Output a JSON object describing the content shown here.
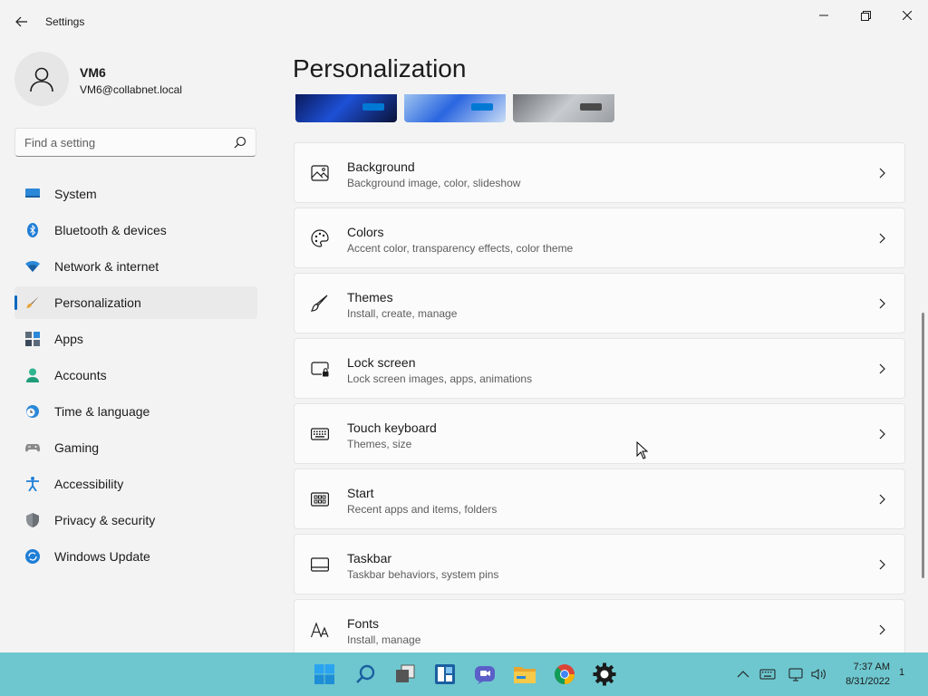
{
  "window": {
    "title": "Settings",
    "controls": {
      "minimize": "minimize",
      "maximize": "maximize",
      "close": "close"
    }
  },
  "profile": {
    "name": "VM6",
    "email": "VM6@collabnet.local"
  },
  "search": {
    "placeholder": "Find a setting"
  },
  "sidebar": {
    "items": [
      {
        "label": "System",
        "icon": "system-icon",
        "selected": false
      },
      {
        "label": "Bluetooth & devices",
        "icon": "bluetooth-icon",
        "selected": false
      },
      {
        "label": "Network & internet",
        "icon": "network-icon",
        "selected": false
      },
      {
        "label": "Personalization",
        "icon": "brush-icon",
        "selected": true
      },
      {
        "label": "Apps",
        "icon": "apps-icon",
        "selected": false
      },
      {
        "label": "Accounts",
        "icon": "accounts-icon",
        "selected": false
      },
      {
        "label": "Time & language",
        "icon": "time-language-icon",
        "selected": false
      },
      {
        "label": "Gaming",
        "icon": "gaming-icon",
        "selected": false
      },
      {
        "label": "Accessibility",
        "icon": "accessibility-icon",
        "selected": false
      },
      {
        "label": "Privacy & security",
        "icon": "shield-icon",
        "selected": false
      },
      {
        "label": "Windows Update",
        "icon": "windows-update-icon",
        "selected": false
      }
    ]
  },
  "main": {
    "title": "Personalization",
    "cards": [
      {
        "title": "Background",
        "subtitle": "Background image, color, slideshow",
        "icon": "image-icon"
      },
      {
        "title": "Colors",
        "subtitle": "Accent color, transparency effects, color theme",
        "icon": "palette-icon"
      },
      {
        "title": "Themes",
        "subtitle": "Install, create, manage",
        "icon": "brush-icon"
      },
      {
        "title": "Lock screen",
        "subtitle": "Lock screen images, apps, animations",
        "icon": "lock-screen-icon"
      },
      {
        "title": "Touch keyboard",
        "subtitle": "Themes, size",
        "icon": "keyboard-icon"
      },
      {
        "title": "Start",
        "subtitle": "Recent apps and items, folders",
        "icon": "start-icon"
      },
      {
        "title": "Taskbar",
        "subtitle": "Taskbar behaviors, system pins",
        "icon": "taskbar-icon"
      },
      {
        "title": "Fonts",
        "subtitle": "Install, manage",
        "icon": "fonts-icon"
      }
    ]
  },
  "colors": {
    "accent": "#0067c0",
    "taskbar": "#6ec7cf"
  },
  "taskbar": {
    "apps": [
      "windows-start-icon",
      "search-icon",
      "task-view-icon",
      "widgets-icon",
      "teams-chat-icon",
      "file-explorer-icon",
      "chrome-icon",
      "settings-gear-icon"
    ],
    "clock": {
      "time": "7:37 AM",
      "date": "8/31/2022"
    },
    "notification_count": "1"
  }
}
